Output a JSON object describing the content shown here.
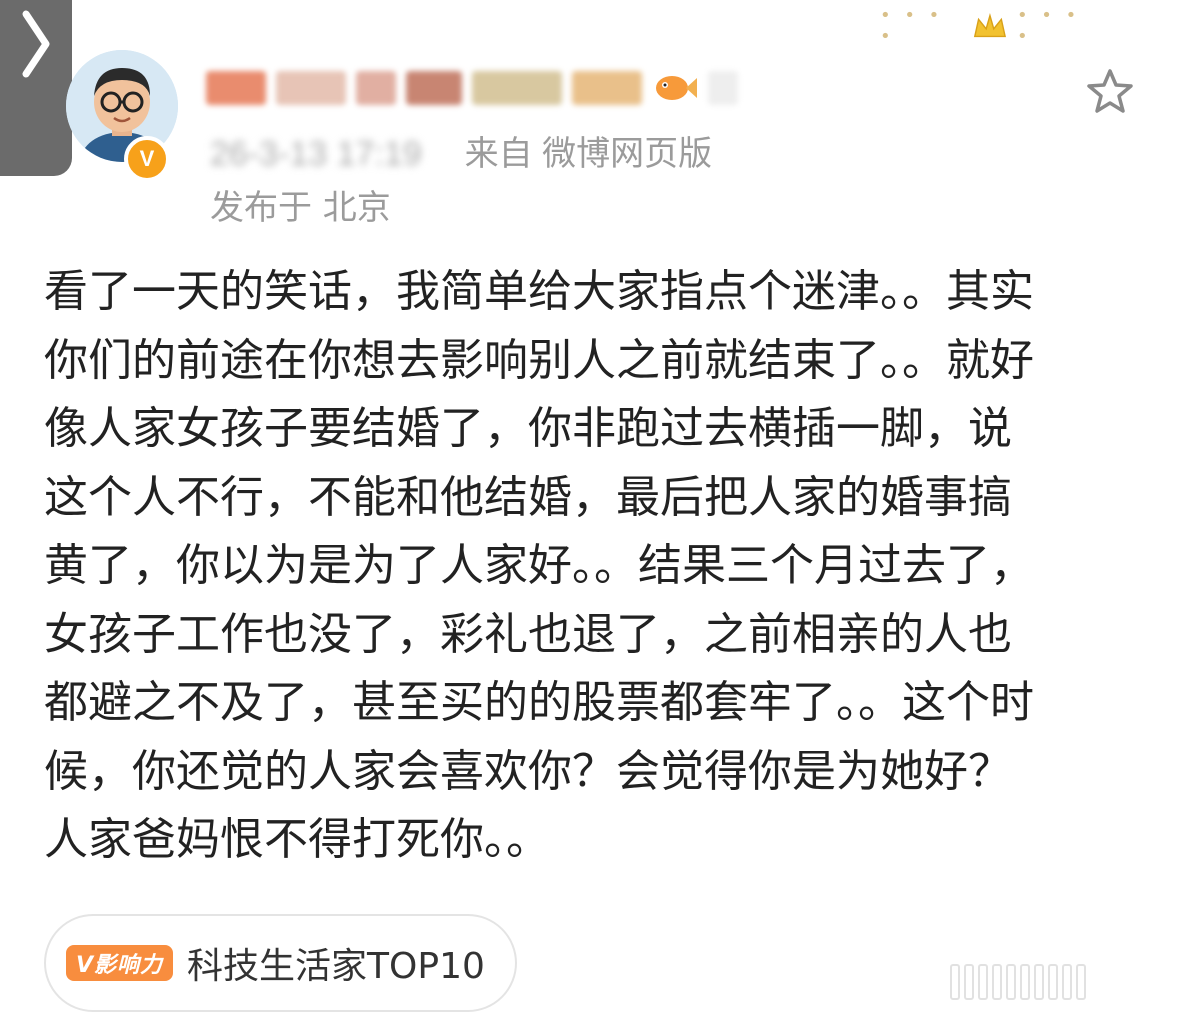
{
  "post": {
    "timestamp": "26-3-13 17:19",
    "source": "来自 微博网页版",
    "location": "发布于 北京",
    "body_lines": [
      "看了一天的笑话，我简单给大家指点个迷津。。其实",
      "你们的前途在你想去影响别人之前就结束了。。就好",
      "像人家女孩子要结婚了，你非跑过去横插一脚，说",
      "这个人不行，不能和他结婚，最后把人家的婚事搞",
      "黄了，你以为是为了人家好。。结果三个月过去了，",
      "女孩子工作也没了，彩礼也退了，之前相亲的人也",
      "都避之不及了，甚至买的的股票都套牢了。。这个时",
      "候，你还觉的人家会喜欢你？会觉得你是为她好？",
      "人家爸妈恨不得打死你。。"
    ]
  },
  "influence": {
    "badge": "V影响力",
    "label": "科技生活家TOP10"
  },
  "colors": {
    "accent_orange": "#f88d3e",
    "verified_badge": "#f7a11a",
    "meta_gray": "#9b9b9b",
    "body_text": "#222222"
  },
  "icons": {
    "back": "chevron-right-icon",
    "favorite": "star-outline-icon",
    "crown": "crown-icon",
    "verified": "v-verified-icon"
  }
}
